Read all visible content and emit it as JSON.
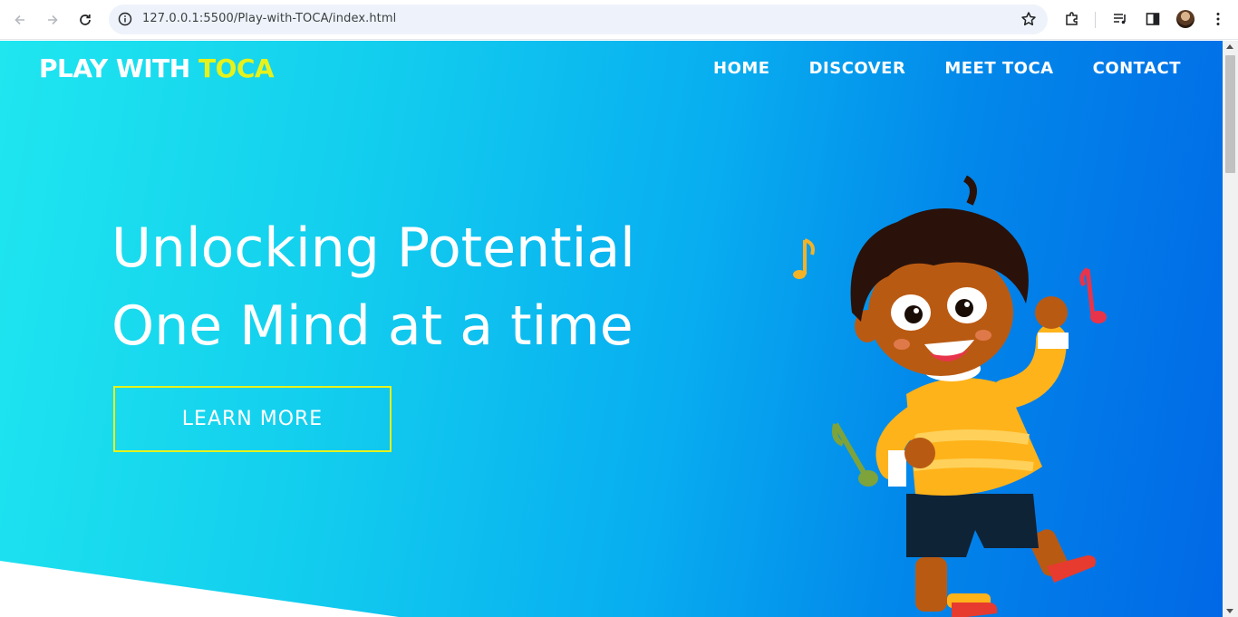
{
  "browser": {
    "url": "127.0.0.1:5500/Play-with-TOCA/index.html"
  },
  "site": {
    "logo_main": "PLAY WITH ",
    "logo_accent": "TOCA",
    "nav": [
      {
        "label": "HOME"
      },
      {
        "label": "DISCOVER"
      },
      {
        "label": "MEET TOCA"
      },
      {
        "label": "CONTACT"
      }
    ],
    "headline_line1": "Unlocking Potential",
    "headline_line2": "One Mind at a time",
    "cta_label": "LEARN MORE"
  },
  "colors": {
    "accent": "#e6f21a",
    "hero_start": "#1fe6ef",
    "hero_end": "#0168e6"
  },
  "icons": [
    "back-icon",
    "forward-icon",
    "reload-icon",
    "info-icon",
    "star-icon",
    "extensions-icon",
    "media-icon",
    "side-panel-icon",
    "menu-icon"
  ]
}
